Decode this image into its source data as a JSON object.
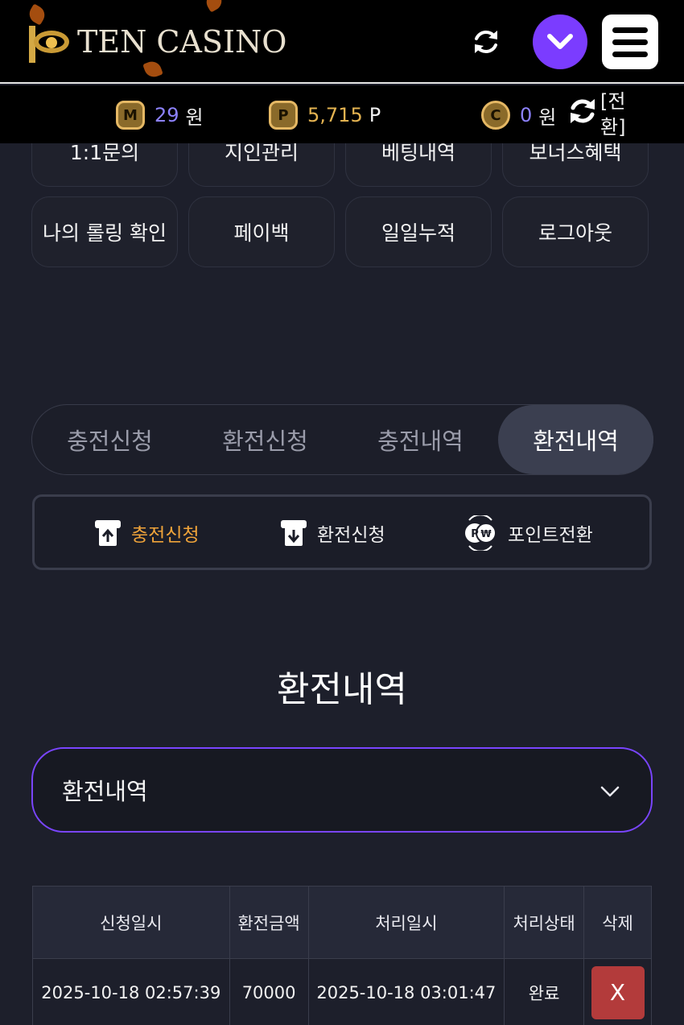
{
  "header": {
    "logo_text": "TEN CASINO",
    "icons": [
      "refresh-icon",
      "chevron-down-icon",
      "hamburger-menu-icon"
    ]
  },
  "balance": {
    "money_badge": "M",
    "money_value": "29",
    "money_unit": "원",
    "point_badge": "P",
    "point_value": "5,715",
    "point_unit": "P",
    "casino_badge": "C",
    "casino_value": "0",
    "casino_unit": "원",
    "convert_label": "[전환]"
  },
  "menu_grid": [
    "1:1문의",
    "지인관리",
    "베팅내역",
    "보너스혜택",
    "나의 롤링 확인",
    "페이백",
    "일일누적",
    "로그아웃"
  ],
  "tabs": [
    "충전신청",
    "환전신청",
    "충전내역",
    "환전내역"
  ],
  "active_tab": "환전내역",
  "subnav": {
    "deposit": "충전신청",
    "withdraw": "환전신청",
    "point_convert": "포인트전환"
  },
  "section_title": "환전내역",
  "select": {
    "value": "환전내역"
  },
  "table": {
    "headers": [
      "신청일시",
      "환전금액",
      "처리일시",
      "처리상태",
      "삭제"
    ],
    "rows": [
      [
        "2025-10-18 02:57:39",
        "70000",
        "2025-10-18 03:01:47",
        "완료",
        "X"
      ]
    ]
  },
  "colors": {
    "accent_purple": "#7b3cff",
    "gold": "#e4b351",
    "active_orange": "#f0a43a",
    "delete_red": "#b33b3b"
  }
}
